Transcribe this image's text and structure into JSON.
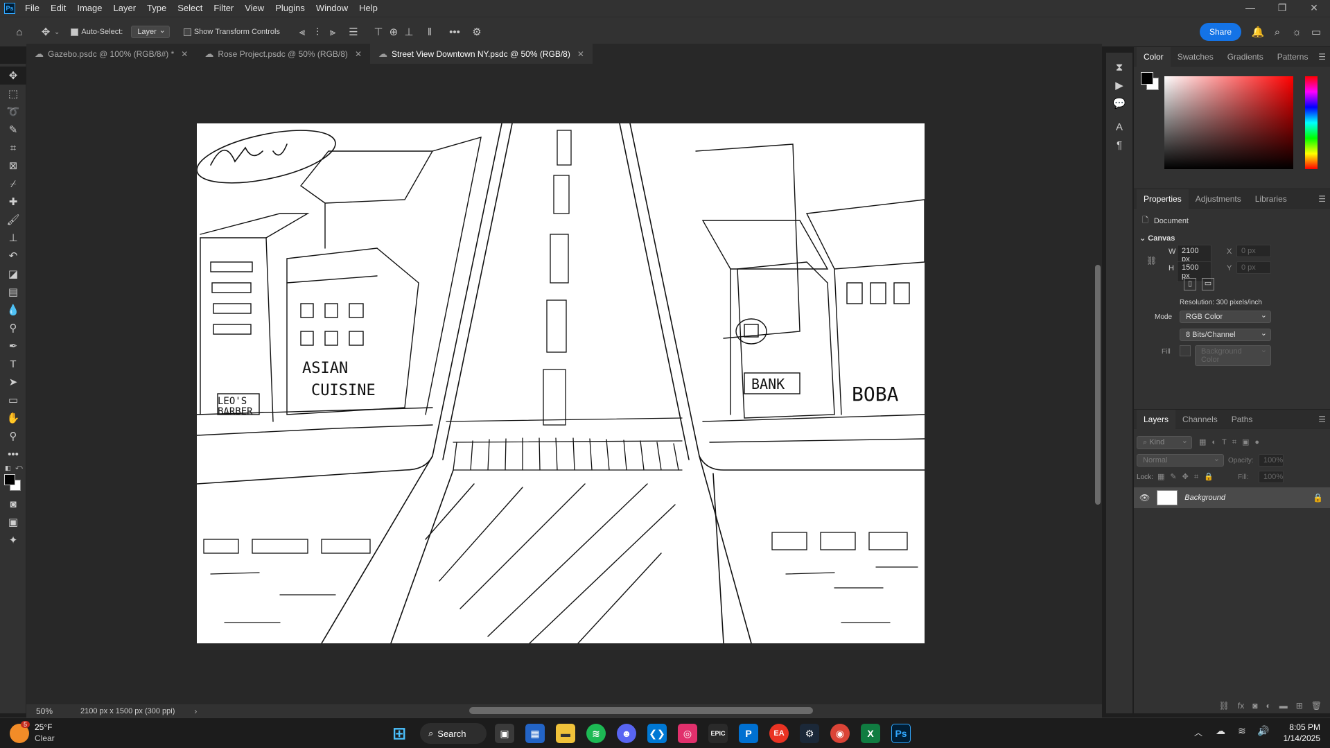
{
  "menubar": {
    "items": [
      "File",
      "Edit",
      "Image",
      "Layer",
      "Type",
      "Select",
      "Filter",
      "View",
      "Plugins",
      "Window",
      "Help"
    ]
  },
  "options": {
    "auto_select_label": "Auto-Select:",
    "auto_select_checked": true,
    "layer_dropdown": "Layer",
    "show_transform_label": "Show Transform Controls",
    "share_label": "Share"
  },
  "tabs": [
    {
      "label": "Gazebo.psdc @ 100% (RGB/8#) *",
      "active": false
    },
    {
      "label": "Rose Project.psdc @ 50% (RGB/8)",
      "active": false
    },
    {
      "label": "Street View Downtown NY.psdc @ 50% (RGB/8)",
      "active": true
    }
  ],
  "status": {
    "zoom": "50%",
    "doc_info": "2100 px x 1500 px (300 ppi)"
  },
  "color_panel": {
    "tabs": [
      "Color",
      "Swatches",
      "Gradients",
      "Patterns"
    ],
    "active_tab": "Color",
    "foreground": "#000000",
    "background": "#ffffff",
    "hue": "#ff0000"
  },
  "properties_panel": {
    "tabs": [
      "Properties",
      "Adjustments",
      "Libraries"
    ],
    "doc_label": "Document",
    "canvas_label": "Canvas",
    "w_label": "W",
    "w_value": "2100 px",
    "h_label": "H",
    "h_value": "1500 px",
    "x_label": "X",
    "x_value": "0 px",
    "y_label": "Y",
    "y_value": "0 px",
    "resolution": "Resolution: 300 pixels/inch",
    "mode_label": "Mode",
    "mode_value": "RGB Color",
    "bits_value": "8 Bits/Channel",
    "fill_label": "Fill",
    "fill_value": "Background Color"
  },
  "layers_panel": {
    "tabs": [
      "Layers",
      "Channels",
      "Paths"
    ],
    "kind_placeholder": "Kind",
    "blend_mode": "Normal",
    "opacity_label": "Opacity:",
    "opacity_value": "100%",
    "lock_label": "Lock:",
    "fill_label": "Fill:",
    "fill_value": "100%",
    "layers": [
      {
        "name": "Background",
        "visible": true,
        "locked": true
      }
    ]
  },
  "taskbar": {
    "weather_badge": "5",
    "weather_temp": "25°F",
    "weather_desc": "Clear",
    "search_label": "Search",
    "time": "8:05 PM",
    "date": "1/14/2025"
  },
  "sketch": {
    "sign_asian_line1": "ASIAN",
    "sign_asian_line2": "CUISINE",
    "sign_barber_line1": "LEO'S",
    "sign_barber_line2": "BARBER",
    "sign_bank": "BANK",
    "sign_boba": "BOBA"
  }
}
